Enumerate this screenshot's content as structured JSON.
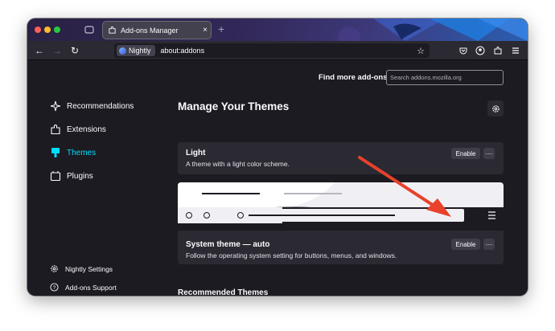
{
  "browser": {
    "tab_title": "Add-ons Manager",
    "tab_close": "×",
    "new_tab": "+",
    "identity_label": "Nightly",
    "url": "about:addons"
  },
  "header": {
    "find_label": "Find more add-ons",
    "search_placeholder": "Search addons.mozilla.org"
  },
  "sidebar": {
    "categories": [
      {
        "label": "Recommendations",
        "icon": "sparkle-icon"
      },
      {
        "label": "Extensions",
        "icon": "puzzle-icon"
      },
      {
        "label": "Themes",
        "icon": "brush-icon",
        "active": true
      },
      {
        "label": "Plugins",
        "icon": "plugin-icon"
      }
    ],
    "footer": [
      {
        "label": "Nightly Settings",
        "icon": "gear-icon"
      },
      {
        "label": "Add-ons Support",
        "icon": "help-icon"
      }
    ]
  },
  "main": {
    "heading": "Manage Your Themes",
    "themes": [
      {
        "name": "Light",
        "description": "A theme with a light color scheme.",
        "button": "Enable",
        "more": "···"
      },
      {
        "name": "System theme — auto",
        "description": "Follow the operating system setting for buttons, menus, and windows.",
        "button": "Enable",
        "more": "···"
      }
    ],
    "recommended_heading": "Recommended Themes"
  },
  "colors": {
    "accent_active": "#00ddff",
    "page_bg": "#1c1b22",
    "card_bg": "#2b2a33",
    "annotation_arrow": "#e8412c"
  }
}
